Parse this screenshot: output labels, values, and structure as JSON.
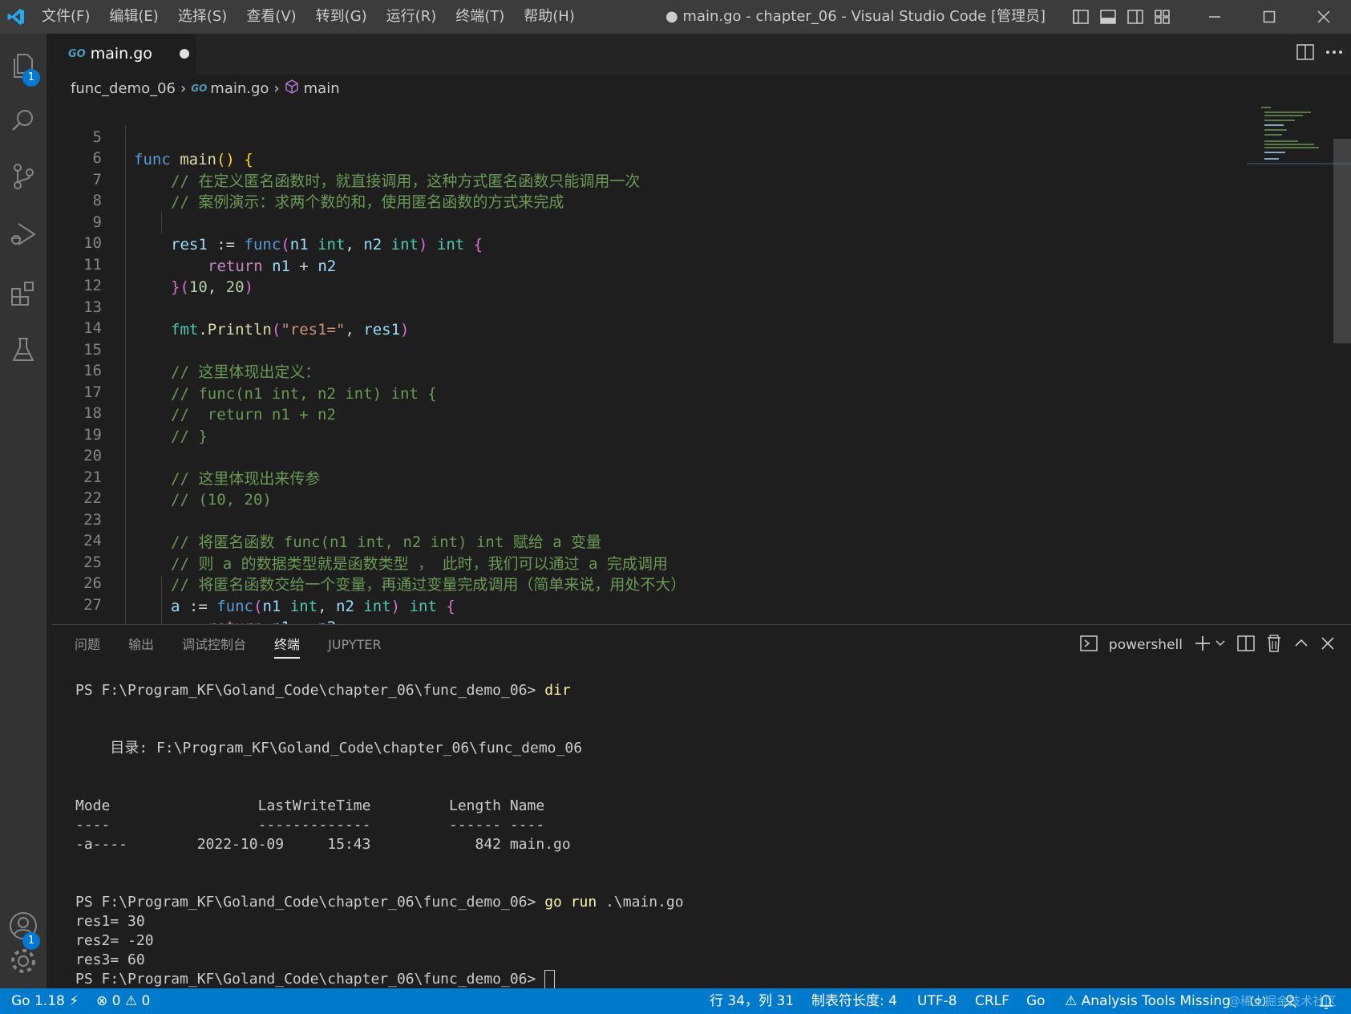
{
  "titlebar": {
    "menu": [
      "文件(F)",
      "编辑(E)",
      "选择(S)",
      "查看(V)",
      "转到(G)",
      "运行(R)",
      "终端(T)",
      "帮助(H)"
    ],
    "title": "● main.go - chapter_06 - Visual Studio Code [管理员]"
  },
  "activity": {
    "explorer_badge": "1",
    "accounts_badge": "1"
  },
  "tab": {
    "go_badge": "GO",
    "label": "main.go"
  },
  "breadcrumb": {
    "folder": "func_demo_06",
    "file": "main.go",
    "symbol": "main",
    "go_badge": "GO"
  },
  "editor": {
    "line_numbers": [
      "5",
      "6",
      "7",
      "8",
      "9",
      "10",
      "11",
      "12",
      "13",
      "14",
      "15",
      "16",
      "17",
      "18",
      "19",
      "20",
      "21",
      "22",
      "23",
      "24",
      "25",
      "26",
      "27"
    ],
    "comments": {
      "l6": "// 在定义匿名函数时，就直接调用，这种方式匿名函数只能调用一次",
      "l7": "// 案例演示：求两个数的和，使用匿名函数的方式来完成",
      "l15": "// 这里体现出定义：",
      "l16": "// func(n1 int, n2 int) int {",
      "l17": "//  return n1 + n2",
      "l18": "// }",
      "l20": "// 这里体现出来传参",
      "l21": "// (10, 20)",
      "l23": "// 将匿名函数 func(n1 int, n2 int) int 赋给 a 变量",
      "l24": "// 则 a 的数据类型就是函数类型 ， 此时，我们可以通过 a 完成调用",
      "l25": "// 将匿名函数交给一个变量，再通过变量完成调用（简单来说，用处不大）"
    }
  },
  "panel": {
    "tabs": [
      "问题",
      "输出",
      "调试控制台",
      "终端",
      "JUPYTER"
    ],
    "active_tab": "终端",
    "shell": "powershell",
    "terminal": {
      "prompt": "PS F:\\Program_KF\\Goland_Code\\chapter_06\\func_demo_06>",
      "cmd1": "dir",
      "dir_line": "    目录: F:\\Program_KF\\Goland_Code\\chapter_06\\func_demo_06",
      "header": "Mode                 LastWriteTime         Length Name",
      "sep": "----                 -------------         ------ ----",
      "row": "-a----        2022-10-09     15:43            842 main.go",
      "cmd2": "go run",
      "cmd2_arg": " .\\main.go",
      "out1": "res1= 30",
      "out2": "res2= -20",
      "out3": "res3= 60"
    }
  },
  "status": {
    "go_version": "Go 1.18",
    "errors": "0",
    "warnings": "0",
    "position": "行 34，列 31",
    "tab_size": "制表符长度: 4",
    "encoding": "UTF-8",
    "eol": "CRLF",
    "language": "Go",
    "analysis": "Analysis Tools Missing",
    "watermark": "@稀土掘金技术社区"
  },
  "colors": {
    "statusbar": "#007acc",
    "accent": "#0078d4"
  }
}
